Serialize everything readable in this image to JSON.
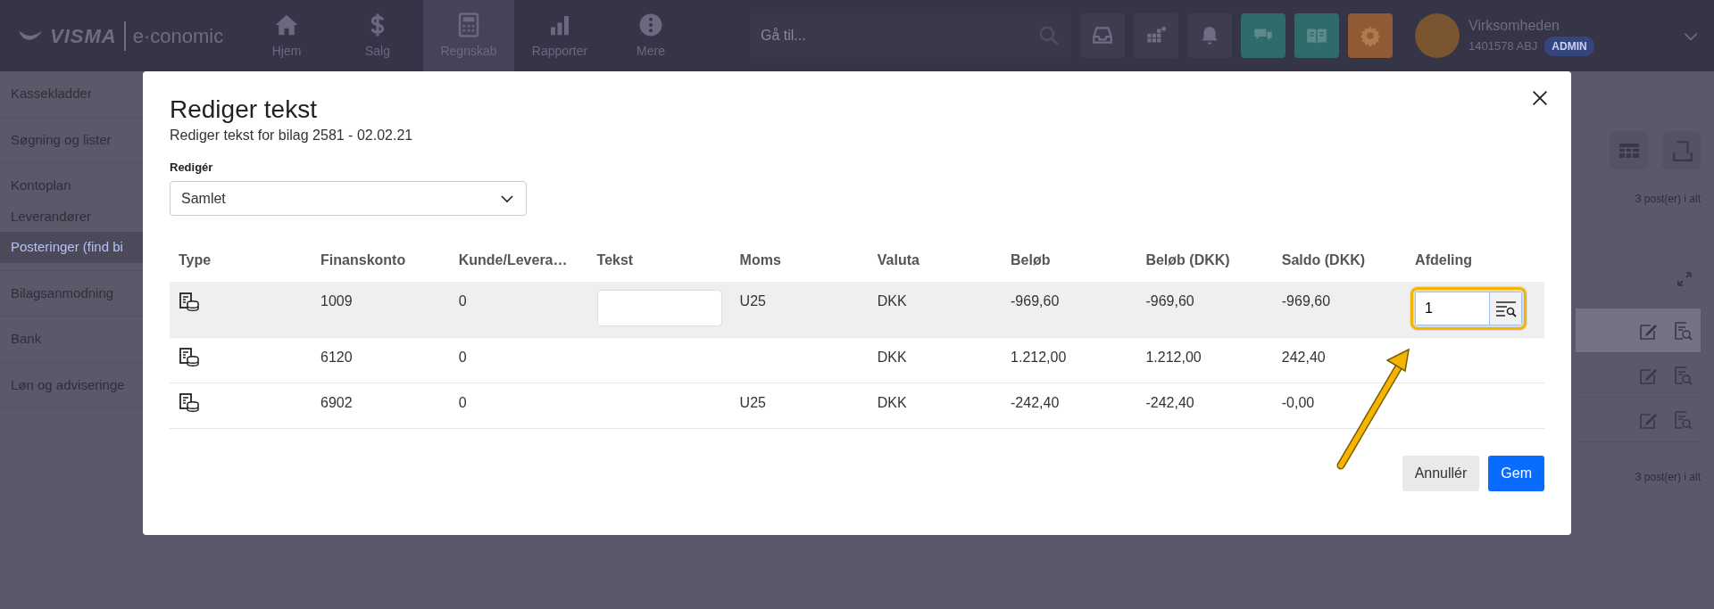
{
  "topbar": {
    "logo": {
      "brand": "VISMA",
      "product": "e·conomic"
    },
    "nav": [
      {
        "label": "Hjem",
        "kind": "home",
        "selected": false
      },
      {
        "label": "Salg",
        "kind": "dollar",
        "selected": false
      },
      {
        "label": "Regnskab",
        "kind": "calculator",
        "selected": true
      },
      {
        "label": "Rapporter",
        "kind": "chart",
        "selected": false
      },
      {
        "label": "Mere",
        "kind": "more",
        "selected": false
      }
    ],
    "search": {
      "placeholder": "Gå til..."
    },
    "actions": [
      {
        "kind": "inbox",
        "color": "#3e3c4e"
      },
      {
        "kind": "apps",
        "color": "#3e3c4e"
      },
      {
        "kind": "bell",
        "color": "#3e3c4e"
      },
      {
        "kind": "chat",
        "color": "#2e6b6a"
      },
      {
        "kind": "book",
        "color": "#2e6b6a"
      },
      {
        "kind": "gear",
        "color": "#8f5a34"
      }
    ],
    "account": {
      "name": "Virksomheden",
      "id": "1401578 ABJ",
      "role": "ADMIN"
    }
  },
  "sidebar": {
    "groups": [
      {
        "items": [
          {
            "label": "Kassekladder",
            "selected": false
          }
        ]
      },
      {
        "items": [
          {
            "label": "Søgning og lister",
            "selected": false
          }
        ]
      },
      {
        "items": [
          {
            "label": "Kontoplan",
            "selected": false
          },
          {
            "label": "Leverandører",
            "selected": false
          },
          {
            "label": "Posteringer (find bi",
            "selected": true
          }
        ]
      },
      {
        "items": [
          {
            "label": "Bilagsanmodning",
            "selected": false
          }
        ]
      },
      {
        "items": [
          {
            "label": "Bank",
            "selected": false
          }
        ]
      },
      {
        "items": [
          {
            "label": "Løn og adviseringe",
            "selected": false
          }
        ]
      }
    ]
  },
  "main": {
    "total_top": "3 post(er) i alt",
    "rows": [
      {
        "selected": true
      },
      {
        "selected": false
      },
      {
        "selected": false
      }
    ],
    "total_bottom": "3 post(er) i alt"
  },
  "modal": {
    "title": "Rediger tekst",
    "subtitle": "Rediger tekst for bilag 2581 - 02.02.21",
    "edit_label": "Redigér",
    "edit_value": "Samlet",
    "columns": [
      "Type",
      "Finanskonto",
      "Kunde/Levera…",
      "Tekst",
      "Moms",
      "Valuta",
      "Beløb",
      "Beløb (DKK)",
      "Saldo (DKK)",
      "Afdeling"
    ],
    "rows": [
      {
        "selected": true,
        "finanskonto": "1009",
        "kunde": "0",
        "moms": "U25",
        "valuta": "DKK",
        "belob": "-969,60",
        "belob_dkk": "-969,60",
        "saldo": "-969,60",
        "afdeling": {
          "value": "1",
          "highlighted": true
        }
      },
      {
        "selected": false,
        "finanskonto": "6120",
        "kunde": "0",
        "valuta": "DKK",
        "belob": "1.212,00",
        "belob_dkk": "1.212,00",
        "saldo": "242,40"
      },
      {
        "selected": false,
        "finanskonto": "6902",
        "kunde": "0",
        "moms": "U25",
        "valuta": "DKK",
        "belob": "-242,40",
        "belob_dkk": "-242,40",
        "saldo": "-0,00"
      }
    ],
    "buttons": [
      {
        "label": "Annullér",
        "kind": "secondary"
      },
      {
        "label": "Gem",
        "kind": "primary"
      }
    ]
  }
}
